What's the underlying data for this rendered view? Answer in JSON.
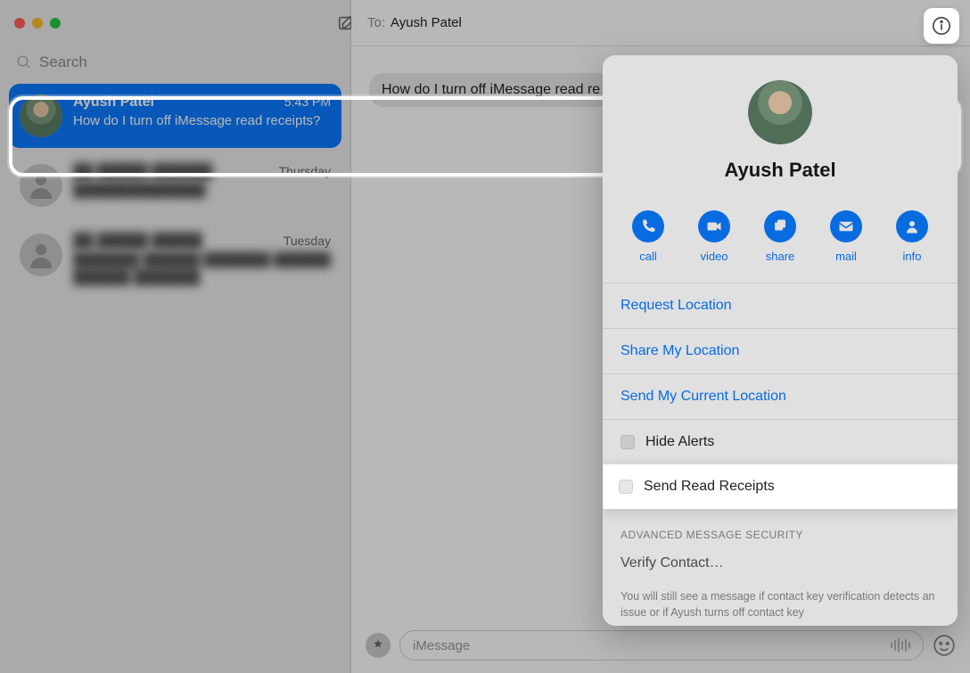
{
  "search": {
    "placeholder": "Search"
  },
  "compose": {
    "placeholder": "iMessage"
  },
  "header": {
    "to_label": "To:",
    "to_name": "Ayush Patel"
  },
  "conversations": [
    {
      "name": "Ayush Patel",
      "time": "5:43 PM",
      "preview": "How do I turn off iMessage read receipts?"
    },
    {
      "name": "██ █████ ██████",
      "time": "Thursday",
      "preview": "██████████████"
    },
    {
      "name": "██ █████ █████",
      "time": "Tuesday",
      "preview": "███████ ██████ ███████ ██████ ██████ ███████"
    }
  ],
  "message": {
    "incoming": "How do I turn off iMessage read re"
  },
  "popover": {
    "name": "Ayush Patel",
    "actions": {
      "call": "call",
      "video": "video",
      "share": "share",
      "mail": "mail",
      "info": "info"
    },
    "request_location": "Request Location",
    "share_my_location": "Share My Location",
    "send_my_location": "Send My Current Location",
    "hide_alerts": "Hide Alerts",
    "send_read_receipts": "Send Read Receipts",
    "advanced_label": "ADVANCED MESSAGE SECURITY",
    "verify_contact": "Verify Contact…",
    "note": "You will still see a message if contact key verification detects an issue or if Ayush turns off contact key"
  }
}
